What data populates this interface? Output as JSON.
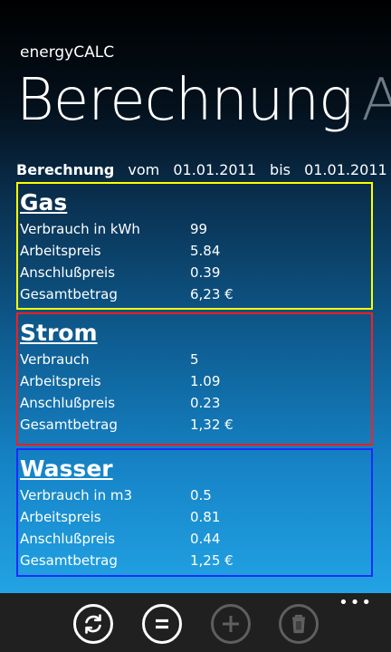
{
  "app": {
    "title": "energyCALC"
  },
  "pivot": {
    "active_label": "Berechnung",
    "next_label": "Au"
  },
  "summary": {
    "label": "Berechnung",
    "from_label": "vom",
    "from_date": "01.01.2011",
    "to_label": "bis",
    "to_date": "01.01.2011"
  },
  "cards": {
    "gas": {
      "title": "Gas",
      "border_color": "#ffff00",
      "rows": [
        {
          "label": "Verbrauch in kWh",
          "value": "99"
        },
        {
          "label": "Arbeitspreis",
          "value": "5.84"
        },
        {
          "label": "Anschlußpreis",
          "value": "0.39"
        },
        {
          "label": "Gesamtbetrag",
          "value": "6,23 €"
        }
      ]
    },
    "strom": {
      "title": "Strom",
      "border_color": "#ff1d1d",
      "rows": [
        {
          "label": "Verbrauch",
          "value": "5"
        },
        {
          "label": "Arbeitspreis",
          "value": "1.09"
        },
        {
          "label": "Anschlußpreis",
          "value": "0.23"
        },
        {
          "label": "Gesamtbetrag",
          "value": "1,32 €"
        }
      ]
    },
    "wasser": {
      "title": "Wasser",
      "border_color": "#1a2cff",
      "rows": [
        {
          "label": "Verbrauch in m3",
          "value": "0.5"
        },
        {
          "label": "Arbeitspreis",
          "value": "0.81"
        },
        {
          "label": "Anschlußpreis",
          "value": "0.44"
        },
        {
          "label": "Gesamtbetrag",
          "value": "1,25 €"
        }
      ]
    }
  },
  "appbar": {
    "buttons": [
      {
        "icon": "refresh-icon",
        "enabled": true
      },
      {
        "icon": "equals-icon",
        "enabled": true
      },
      {
        "icon": "add-icon",
        "enabled": false
      },
      {
        "icon": "delete-icon",
        "enabled": false
      }
    ],
    "more_label": "•••"
  }
}
